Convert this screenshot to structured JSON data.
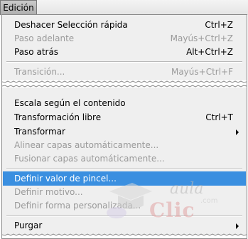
{
  "menubar": {
    "tab_label": "Edición"
  },
  "menu": {
    "items": [
      {
        "label": "Deshacer Selección rápida",
        "shortcut": "Ctrl+Z"
      },
      {
        "label": "Paso adelante",
        "shortcut": "Mayús+Ctrl+Z"
      },
      {
        "label": "Paso atrás",
        "shortcut": "Alt+Ctrl+Z"
      },
      {
        "label": "Transición...",
        "shortcut": "Mayús+Ctrl+F"
      },
      {
        "label": "Escala según el contenido"
      },
      {
        "label": "Transformación libre",
        "shortcut": "Ctrl+T"
      },
      {
        "label": "Transformar"
      },
      {
        "label": "Alinear capas automáticamente..."
      },
      {
        "label": "Fusionar capas automáticamente..."
      },
      {
        "label": "Definir valor de pincel..."
      },
      {
        "label": "Definir motivo..."
      },
      {
        "label": "Definir forma personalizada..."
      },
      {
        "label": "Purgar"
      }
    ]
  },
  "watermark": {
    "line1": "aula",
    "line2": "Clic",
    "suffix": ".com"
  },
  "colors": {
    "highlight": "#3a8fe0",
    "disabled": "#9a9a9a",
    "menu_bg": "#efefef"
  }
}
